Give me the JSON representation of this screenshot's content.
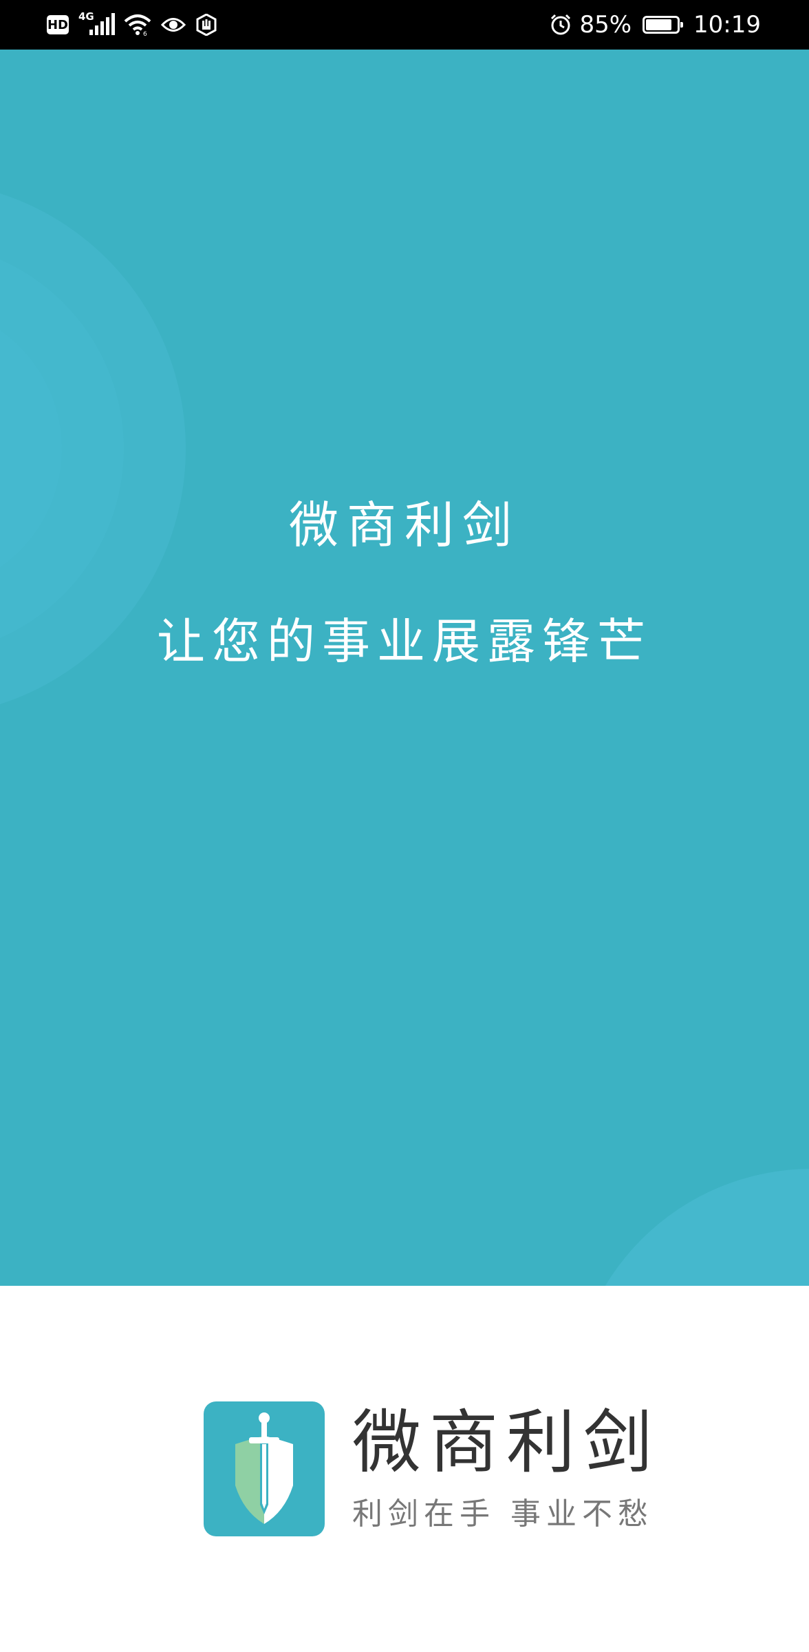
{
  "status_bar": {
    "hd_label": "HD",
    "network_label": "4G",
    "battery_percent": 85,
    "battery_text": "85%",
    "time": "10:19",
    "icons": [
      "hd-icon",
      "signal-icon",
      "wifi-icon",
      "eye-icon",
      "hand-icon",
      "alarm-icon",
      "battery-icon"
    ]
  },
  "hero": {
    "title": "微商利剑",
    "slogan": "让您的事业展露锋芒",
    "background_color": "#3cb2c3"
  },
  "brand": {
    "name": "微商利剑",
    "tagline": "利剑在手 事业不愁",
    "icon": "sword-shield-icon",
    "accent_color": "#3cb2c3"
  }
}
